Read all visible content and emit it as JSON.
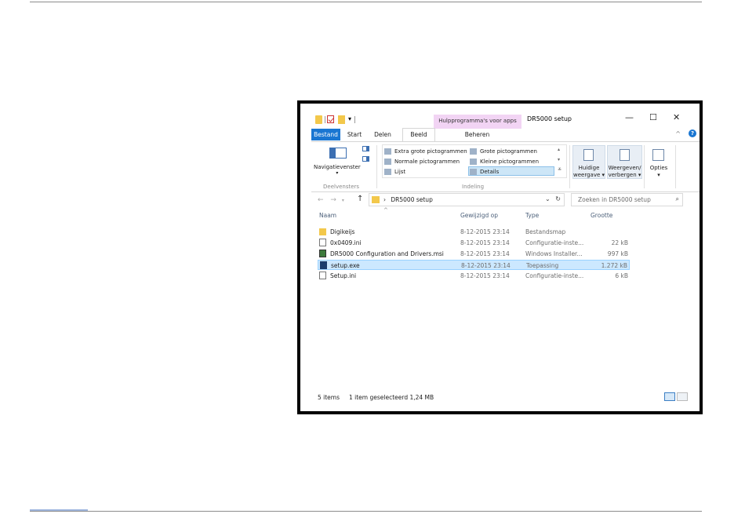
{
  "window": {
    "title": "DR5000 setup",
    "context_tab": "Hulpprogramma's voor apps",
    "controls": {
      "minimize": "—",
      "maximize": "☐",
      "close": "✕"
    },
    "qa_dropdown": "▾"
  },
  "tabs": {
    "file": "Bestand",
    "start": "Start",
    "share": "Delen",
    "view": "Beeld",
    "manage": "Beheren",
    "collapse": "^",
    "help": "?"
  },
  "ribbon": {
    "navpane_label": "Navigatievenster",
    "navpane_arrow": "▾",
    "panes_group": "Deelvensters",
    "layout_group": "Indeling",
    "layout_items": [
      "Extra grote pictogrammen",
      "Grote pictogrammen",
      "Normale pictogrammen",
      "Kleine pictogrammen",
      "Lijst",
      "Details"
    ],
    "layout_scroll_up": "▴",
    "layout_scroll_down": "▾",
    "layout_more": "≚",
    "current_view_line1": "Huidige",
    "current_view_line2": "weergave ▾",
    "show_hide_line1": "Weergeven/",
    "show_hide_line2": "verbergen ▾",
    "options_label": "Opties",
    "options_arrow": "▾"
  },
  "nav": {
    "back": "←",
    "forward": "→",
    "recent": "▾",
    "up": "↑"
  },
  "address": {
    "separator": "›",
    "path": "DR5000 setup",
    "dropdown": "⌄",
    "refresh": "↻"
  },
  "search": {
    "placeholder": "Zoeken in DR5000 setup",
    "icon": "⌕"
  },
  "list": {
    "sort_indicator": "^",
    "columns": {
      "name": "Naam",
      "modified": "Gewijzigd op",
      "type": "Type",
      "size": "Grootte"
    },
    "rows": [
      {
        "name": "Digikeijs",
        "modified": "8-12-2015 23:14",
        "type": "Bestandsmap",
        "size": "",
        "icon": "folder-icon"
      },
      {
        "name": "0x0409.ini",
        "modified": "8-12-2015 23:14",
        "type": "Configuratie-inste...",
        "size": "22 kB",
        "icon": "ini-file-icon"
      },
      {
        "name": "DR5000 Configuration and Drivers.msi",
        "modified": "8-12-2015 23:14",
        "type": "Windows Installer...",
        "size": "997 kB",
        "icon": "msi-file-icon"
      },
      {
        "name": "setup.exe",
        "modified": "8-12-2015 23:14",
        "type": "Toepassing",
        "size": "1.272 kB",
        "icon": "exe-file-icon",
        "selected": true
      },
      {
        "name": "Setup.ini",
        "modified": "8-12-2015 23:14",
        "type": "Configuratie-inste...",
        "size": "6 kB",
        "icon": "ini-file-icon"
      }
    ]
  },
  "status": {
    "items": "5 items",
    "selection": "1 item geselecteerd  1,24 MB"
  }
}
